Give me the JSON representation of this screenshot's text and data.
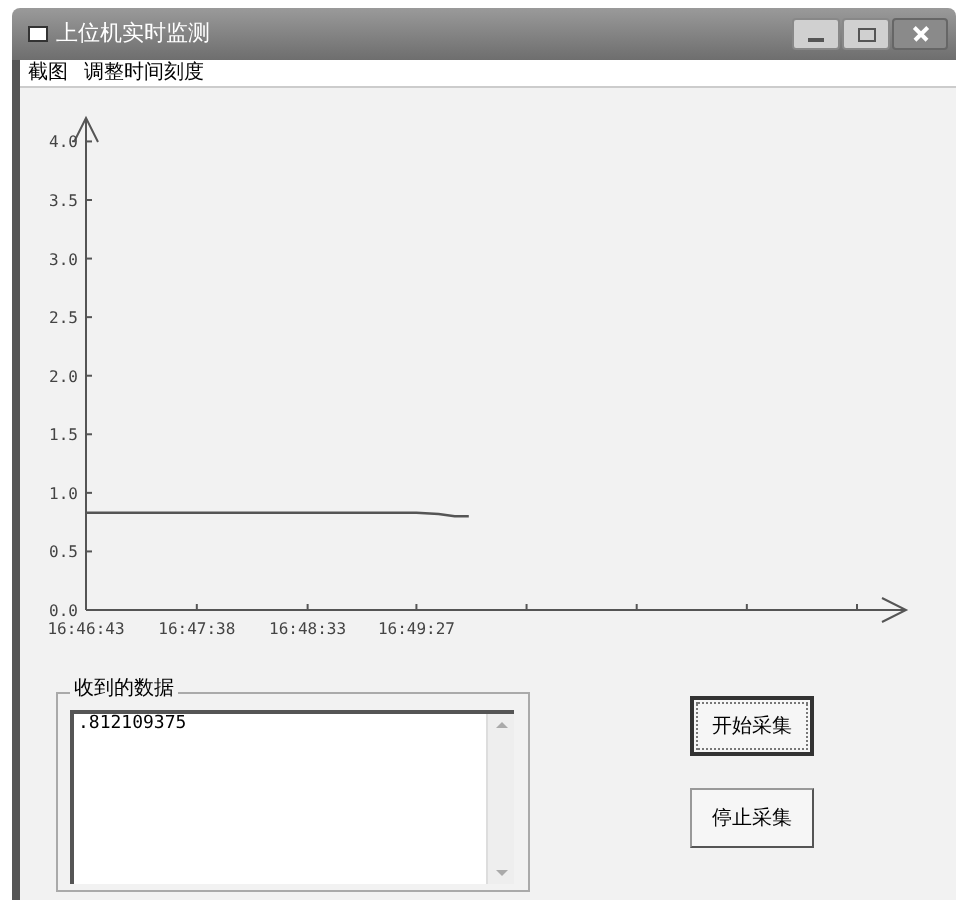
{
  "window": {
    "title": "上位机实时监测"
  },
  "menu": [
    {
      "label": "截图"
    },
    {
      "label": "调整时间刻度"
    }
  ],
  "chart": {
    "chart_data": {
      "type": "line",
      "x": [
        60403,
        60430,
        60458,
        60485,
        60513,
        60540,
        60567,
        60578,
        60586,
        60593
      ],
      "series": [
        {
          "color": "#555555",
          "values": [
            0.83,
            0.83,
            0.83,
            0.83,
            0.83,
            0.83,
            0.83,
            0.82,
            0.8,
            0.8
          ]
        }
      ],
      "xlim": [
        60403,
        60810
      ],
      "ylim": [
        0,
        4.2
      ],
      "xticks": [
        {
          "value": 60403,
          "label": "16:46:43"
        },
        {
          "value": 60458,
          "label": "16:47:38"
        },
        {
          "value": 60513,
          "label": "16:48:33"
        },
        {
          "value": 60567,
          "label": "16:49:27"
        }
      ],
      "yticks": [
        {
          "value": 0,
          "label": "0.0"
        },
        {
          "value": 0.5,
          "label": "0.5"
        },
        {
          "value": 1,
          "label": "1.0"
        },
        {
          "value": 1.5,
          "label": "1.5"
        },
        {
          "value": 2,
          "label": "2.0"
        },
        {
          "value": 2.5,
          "label": "2.5"
        },
        {
          "value": 3,
          "label": "3.0"
        },
        {
          "value": 3.5,
          "label": "3.5"
        },
        {
          "value": 4,
          "label": "4.0"
        }
      ]
    }
  },
  "received": {
    "label": "收到的数据",
    "value": ".812109375"
  },
  "buttons": [
    {
      "label": "开始采集",
      "focused": true
    },
    {
      "label": "停止采集",
      "focused": false
    }
  ]
}
